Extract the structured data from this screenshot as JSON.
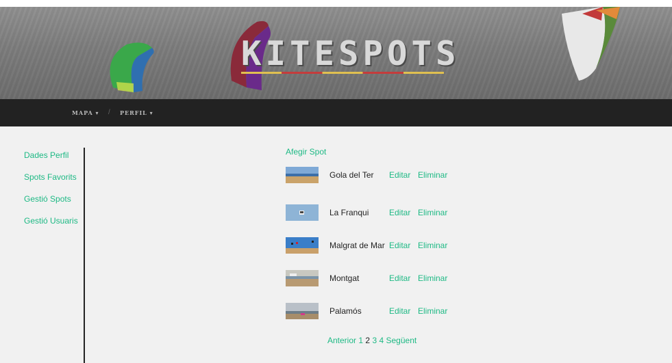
{
  "header": {
    "brand": "KITESPOTS"
  },
  "nav": {
    "mapa": "MAPA",
    "perfil": "PERFIL",
    "separator": "/"
  },
  "sidebar": {
    "items": [
      {
        "label": "Dades Perfil"
      },
      {
        "label": "Spots Favorits"
      },
      {
        "label": "Gestió Spots"
      },
      {
        "label": "Gestió Usuaris"
      }
    ]
  },
  "main": {
    "add_label": "Afegir Spot",
    "edit_label": "Editar",
    "delete_label": "Eliminar",
    "spots": [
      {
        "name": "Gola del Ter"
      },
      {
        "name": "La Franqui"
      },
      {
        "name": "Malgrat de Mar"
      },
      {
        "name": "Montgat"
      },
      {
        "name": "Palamós"
      }
    ]
  },
  "pagination": {
    "prev": "Anterior",
    "pages": [
      "1",
      "2",
      "3",
      "4"
    ],
    "current": "2",
    "next": "Següent"
  },
  "colors": {
    "accent": "#1db984",
    "navbar": "#222222",
    "background": "#f1f1f1"
  }
}
